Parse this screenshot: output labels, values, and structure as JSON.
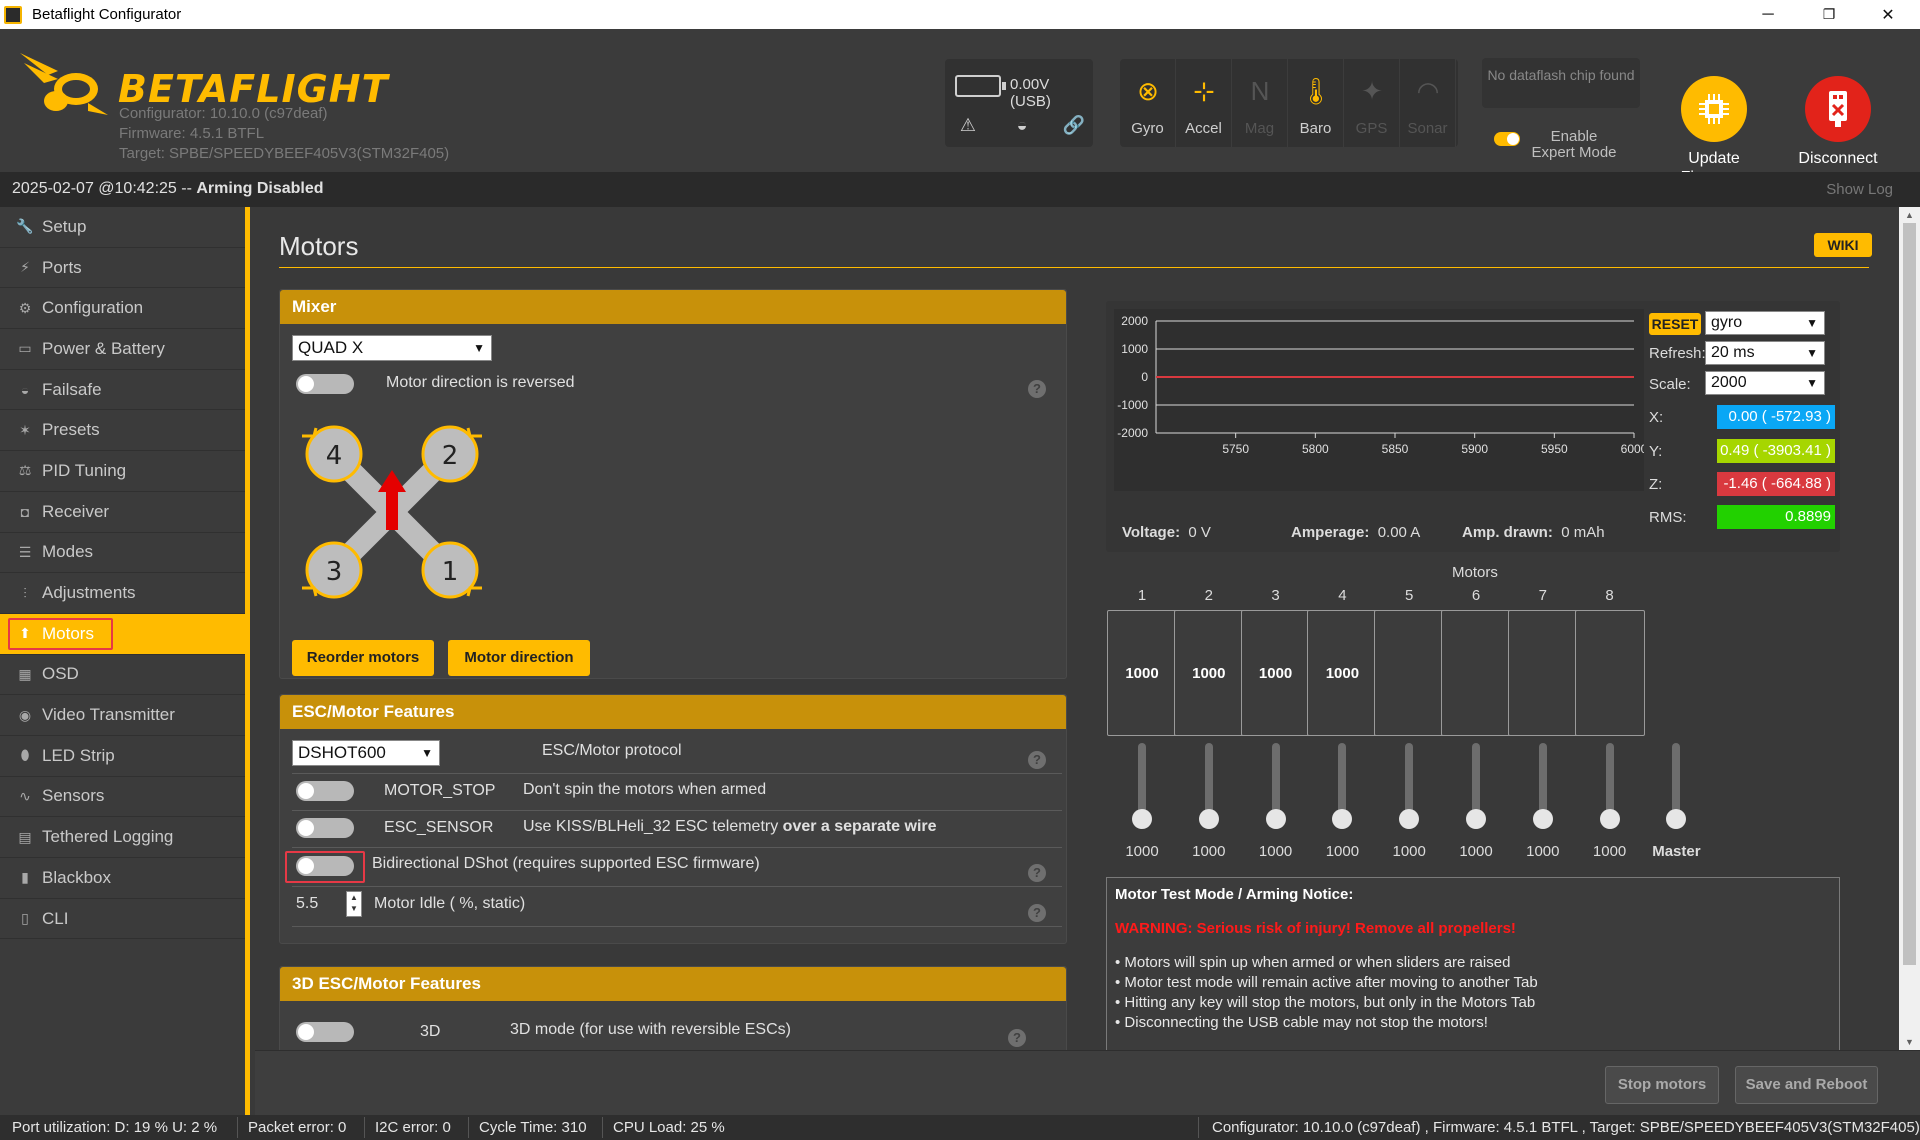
{
  "window": {
    "title": "Betaflight Configurator",
    "minimize": "─",
    "maximize": "❐",
    "close": "✕"
  },
  "header": {
    "logo_text": "BETAFLIGHT",
    "configurator": "Configurator: 10.10.0 (c97deaf)",
    "firmware": "Firmware: 4.5.1 BTFL",
    "target": "Target: SPBE/SPEEDYBEEF405V3(STM32F405)",
    "battery": "0.00V (USB)",
    "sensors": [
      {
        "name": "Gyro",
        "state": "on"
      },
      {
        "name": "Accel",
        "state": "on"
      },
      {
        "name": "Mag",
        "state": "off"
      },
      {
        "name": "Baro",
        "state": "on"
      },
      {
        "name": "GPS",
        "state": "off"
      },
      {
        "name": "Sonar",
        "state": "off"
      }
    ],
    "dataflash": "No dataflash chip found",
    "expert_mode_label": "Enable Expert Mode",
    "update_label": "Update Firmware",
    "disconnect_label": "Disconnect",
    "colors": {
      "accent": "#ffbb00",
      "disconnect": "#e2231a"
    }
  },
  "statusline": {
    "timestamp": "2025-02-07 @10:42:25 --",
    "status": "Arming Disabled",
    "show_log": "Show Log"
  },
  "sidebar": {
    "items": [
      {
        "label": "Setup",
        "icon": "wrench-icon",
        "glyph": "🔧"
      },
      {
        "label": "Ports",
        "icon": "plug-icon",
        "glyph": "⚡"
      },
      {
        "label": "Configuration",
        "icon": "gear-icon",
        "glyph": "⚙"
      },
      {
        "label": "Power & Battery",
        "icon": "battery-icon",
        "glyph": "▭"
      },
      {
        "label": "Failsafe",
        "icon": "parachute-icon",
        "glyph": "◒"
      },
      {
        "label": "Presets",
        "icon": "magic-icon",
        "glyph": "✶"
      },
      {
        "label": "PID Tuning",
        "icon": "sitemap-icon",
        "glyph": "⚖"
      },
      {
        "label": "Receiver",
        "icon": "receiver-icon",
        "glyph": "◘"
      },
      {
        "label": "Modes",
        "icon": "toggles-icon",
        "glyph": "☰"
      },
      {
        "label": "Adjustments",
        "icon": "sliders-icon",
        "glyph": "⫶"
      },
      {
        "label": "Motors",
        "icon": "motor-icon",
        "glyph": "⬆",
        "active": true
      },
      {
        "label": "OSD",
        "icon": "osd-icon",
        "glyph": "▦"
      },
      {
        "label": "Video Transmitter",
        "icon": "broadcast-icon",
        "glyph": "◉"
      },
      {
        "label": "LED Strip",
        "icon": "led-icon",
        "glyph": "⬮"
      },
      {
        "label": "Sensors",
        "icon": "pulse-icon",
        "glyph": "∿"
      },
      {
        "label": "Tethered Logging",
        "icon": "logging-icon",
        "glyph": "▤"
      },
      {
        "label": "Blackbox",
        "icon": "blackbox-icon",
        "glyph": "▮"
      },
      {
        "label": "CLI",
        "icon": "terminal-icon",
        "glyph": "▯"
      }
    ]
  },
  "main": {
    "title": "Motors",
    "wiki": "WIKI",
    "mixer": {
      "header": "Mixer",
      "type": "QUAD X",
      "reversed_label": "Motor direction is reversed",
      "motor_labels": [
        "4",
        "2",
        "3",
        "1"
      ],
      "reorder_btn": "Reorder motors",
      "direction_btn": "Motor direction"
    },
    "esc": {
      "header": "ESC/Motor Features",
      "protocol": "DSHOT600",
      "protocol_label": "ESC/Motor protocol",
      "motor_stop": "MOTOR_STOP",
      "motor_stop_desc": "Don't spin the motors when armed",
      "esc_sensor": "ESC_SENSOR",
      "esc_sensor_desc": "Use KISS/BLHeli_32 ESC telemetry",
      "esc_sensor_desc_bold": "over a separate wire",
      "bidir": "Bidirectional DShot (requires supported ESC firmware)",
      "idle_value": "5.5",
      "idle_label": "Motor Idle ( %, static)"
    },
    "esc3d": {
      "header": "3D ESC/Motor Features",
      "label": "3D",
      "desc": "3D mode (for use with reversible ESCs)"
    },
    "graph": {
      "reset": "RESET",
      "source": "gyro",
      "refresh_label": "Refresh:",
      "refresh": "20 ms",
      "scale_label": "Scale:",
      "scale": "2000",
      "x_label": "X:",
      "x_val": "0.00 ( -572.93 )",
      "y_label": "Y:",
      "y_val": "0.49 ( -3903.41 )",
      "z_label": "Z:",
      "z_val": "-1.46 ( -664.88 )",
      "rms_label": "RMS:",
      "rms_val": "0.8899",
      "voltage_label": "Voltage:",
      "voltage": "0 V",
      "amperage_label": "Amperage:",
      "amperage": "0.00 A",
      "drawn_label": "Amp. drawn:",
      "drawn": "0 mAh",
      "colors": {
        "x": "#0aa7f5",
        "y": "#a6d600",
        "z": "#d9393f",
        "rms": "#22d100"
      }
    },
    "motors": {
      "title": "Motors",
      "numbers": [
        "1",
        "2",
        "3",
        "4",
        "5",
        "6",
        "7",
        "8"
      ],
      "box_values": [
        "1000",
        "1000",
        "1000",
        "1000",
        "",
        "",
        "",
        ""
      ],
      "slider_values": [
        "1000",
        "1000",
        "1000",
        "1000",
        "1000",
        "1000",
        "1000",
        "1000"
      ],
      "master_label": "Master"
    },
    "notice": {
      "title": "Motor Test Mode / Arming Notice:",
      "warning": "WARNING: Serious risk of injury! Remove all propellers!",
      "items": [
        "• Motors will spin up when armed or when sliders are raised",
        "• Motor test mode will remain active after moving to another Tab",
        "• Hitting any key will stop the motors, but only in the Motors Tab",
        "• Disconnecting the USB cable may not stop the motors!"
      ]
    },
    "actions": {
      "stop": "Stop motors",
      "save": "Save and Reboot"
    }
  },
  "chart_data": {
    "type": "line",
    "x_ticks": [
      "5750",
      "5800",
      "5850",
      "5900",
      "5950",
      "6000"
    ],
    "y_ticks": [
      "2000",
      "1000",
      "0",
      "-1000",
      "-2000"
    ],
    "ylim": [
      -2000,
      2000
    ],
    "xlim": [
      5700,
      6000
    ],
    "series": [
      {
        "values": [
          0,
          0
        ]
      }
    ]
  },
  "footer": {
    "port_util": "Port utilization: D: 19 % U: 2 %",
    "packet_error": "Packet error: 0",
    "i2c_error": "I2C error: 0",
    "cycle_time": "Cycle Time: 310",
    "cpu_load": "CPU Load: 25 %",
    "version": "Configurator: 10.10.0 (c97deaf) , Firmware: 4.5.1 BTFL , Target: SPBE/SPEEDYBEEF405V3(STM32F405)"
  }
}
